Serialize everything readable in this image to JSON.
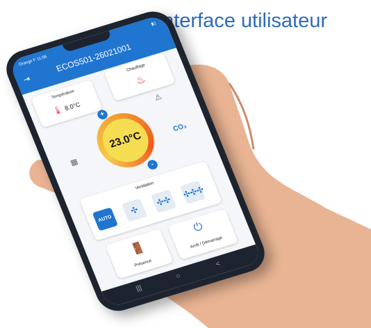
{
  "caption": "Interface utilisateur",
  "status": {
    "carrier": "Orange F",
    "time": "11:06"
  },
  "header": {
    "title": "ECOS501-26021001"
  },
  "temperature": {
    "label": "Température",
    "value": "8.0°C"
  },
  "heating": {
    "label": "Chauffage"
  },
  "setpoint": {
    "value": "23.0°C",
    "plus": "+",
    "minus": "-"
  },
  "co2": {
    "label": "CO₂"
  },
  "ventilation": {
    "label": "Ventilation",
    "auto_label": "AUTO"
  },
  "power": {
    "label": "Arrêt / Démarrage"
  },
  "presence": {
    "label": "Présence"
  },
  "colors": {
    "header": "#1f75d0",
    "dial": "#f5dd52",
    "accent": "#2f6cb8"
  }
}
